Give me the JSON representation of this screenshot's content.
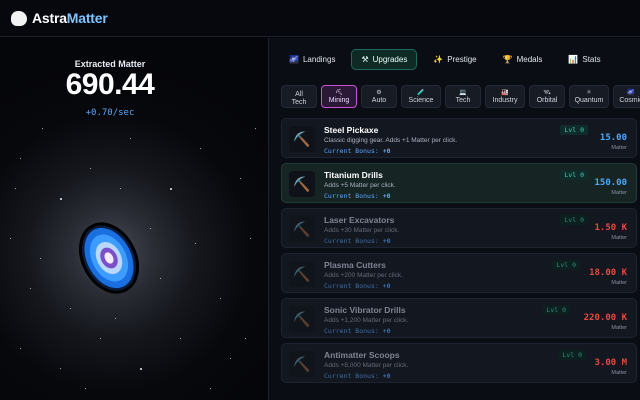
{
  "app": {
    "name_a": "Astra",
    "name_b": "Matter"
  },
  "matter": {
    "label": "Extracted Matter",
    "value": "690.44",
    "rate": "+0.70/sec"
  },
  "tabs": [
    {
      "icon": "🌌",
      "label": "Landings",
      "active": false
    },
    {
      "icon": "⚒",
      "label": "Upgrades",
      "active": true
    },
    {
      "icon": "✨",
      "label": "Prestige",
      "active": false
    },
    {
      "icon": "🏆",
      "label": "Medals",
      "active": false
    },
    {
      "icon": "📊",
      "label": "Stats",
      "active": false
    }
  ],
  "categories": [
    {
      "icon": "",
      "label": "All Tech"
    },
    {
      "icon": "⛏",
      "label": "Mining"
    },
    {
      "icon": "⚙",
      "label": "Auto"
    },
    {
      "icon": "🧪",
      "label": "Science"
    },
    {
      "icon": "💻",
      "label": "Tech"
    },
    {
      "icon": "🏭",
      "label": "Industry"
    },
    {
      "icon": "🛰",
      "label": "Orbital"
    },
    {
      "icon": "⚛",
      "label": "Quantum"
    },
    {
      "icon": "🌌",
      "label": "Cosmic"
    }
  ],
  "upgrades": [
    {
      "icon": "pickaxe-icon",
      "name": "Steel Pickaxe",
      "desc": "Classic digging gear. Adds +1 Matter per click.",
      "bonus_label": "Current Bonus:",
      "bonus": "+0",
      "level": "Lvl 0",
      "cost": "15.00",
      "unit": "Matter",
      "affordable": true
    },
    {
      "icon": "pickaxe-icon",
      "name": "Titanium Drills",
      "desc": "Adds +5 Matter per click.",
      "bonus_label": "Current Bonus:",
      "bonus": "+0",
      "level": "Lvl 0",
      "cost": "150.00",
      "unit": "Matter",
      "affordable": true
    },
    {
      "icon": "pickaxe-icon",
      "name": "Laser Excavators",
      "desc": "Adds +30 Matter per click.",
      "bonus_label": "Current Bonus:",
      "bonus": "+0",
      "level": "Lvl 0",
      "cost": "1.50 K",
      "unit": "Matter",
      "affordable": false
    },
    {
      "icon": "pickaxe-icon",
      "name": "Plasma Cutters",
      "desc": "Adds +200 Matter per click.",
      "bonus_label": "Current Bonus:",
      "bonus": "+0",
      "level": "Lvl 0",
      "cost": "18.00 K",
      "unit": "Matter",
      "affordable": false
    },
    {
      "icon": "pickaxe-icon",
      "name": "Sonic Vibrator Drills",
      "desc": "Adds +1,200 Matter per click.",
      "bonus_label": "Current Bonus:",
      "bonus": "+0",
      "level": "Lvl 0",
      "cost": "220.00 K",
      "unit": "Matter",
      "affordable": false
    },
    {
      "icon": "pickaxe-icon",
      "name": "Antimatter Scoops",
      "desc": "Adds +8,000 Matter per click.",
      "bonus_label": "Current Bonus:",
      "bonus": "+0",
      "level": "Lvl 0",
      "cost": "3.00 M",
      "unit": "Matter",
      "affordable": false
    }
  ],
  "colors": {
    "accent": "#1d6b58",
    "mining_active": "#c74fd6",
    "cost_ok": "#4aa9ff",
    "cost_no": "#e24a3f"
  }
}
